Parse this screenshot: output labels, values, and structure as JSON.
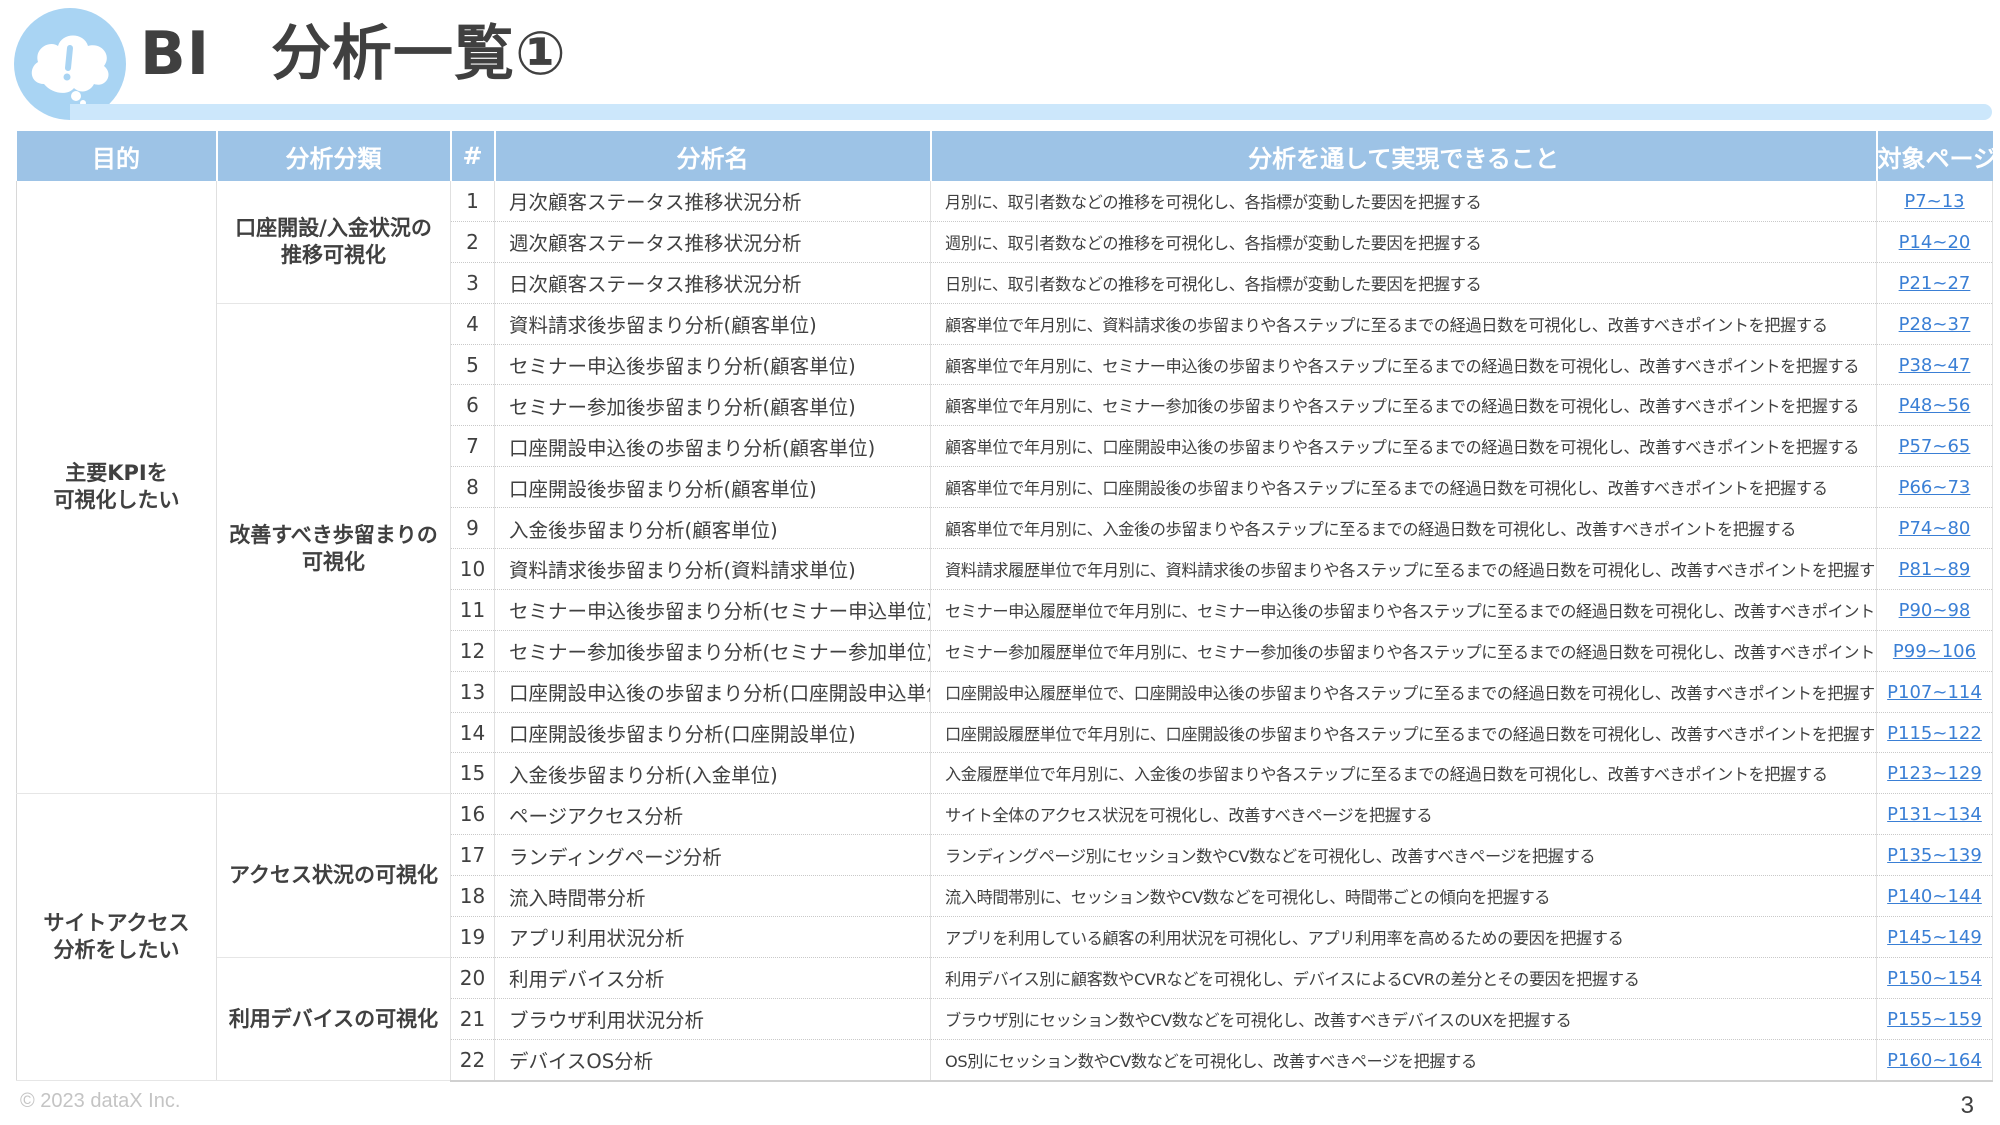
{
  "header": {
    "title": "BI　分析一覧①",
    "logo_icon": "cloud-exclamation-icon"
  },
  "table": {
    "columns": [
      "目的",
      "分析分類",
      "#",
      "分析名",
      "分析を通して実現できること",
      "対象ページ"
    ],
    "purposes": [
      "主要KPIを\n可視化したい",
      "サイトアクセス\n分析をしたい"
    ],
    "categories": [
      "口座開設/入金状況の\n推移可視化",
      "改善すべき歩留まりの\n可視化",
      "アクセス状況の可視化",
      "利用デバイスの可視化"
    ],
    "rows": [
      {
        "no": "1",
        "name": "月次顧客ステータス推移状況分析",
        "desc": "月別に、取引者数などの推移を可視化し、各指標が変動した要因を把握する",
        "page": "P7~13"
      },
      {
        "no": "2",
        "name": "週次顧客ステータス推移状況分析",
        "desc": "週別に、取引者数などの推移を可視化し、各指標が変動した要因を把握する",
        "page": "P14~20"
      },
      {
        "no": "3",
        "name": "日次顧客ステータス推移状況分析",
        "desc": "日別に、取引者数などの推移を可視化し、各指標が変動した要因を把握する",
        "page": "P21~27"
      },
      {
        "no": "4",
        "name": "資料請求後歩留まり分析(顧客単位)",
        "desc": "顧客単位で年月別に、資料請求後の歩留まりや各ステップに至るまでの経過日数を可視化し、改善すべきポイントを把握する",
        "page": "P28~37"
      },
      {
        "no": "5",
        "name": "セミナー申込後歩留まり分析(顧客単位)",
        "desc": "顧客単位で年月別に、セミナー申込後の歩留まりや各ステップに至るまでの経過日数を可視化し、改善すべきポイントを把握する",
        "page": "P38~47"
      },
      {
        "no": "6",
        "name": "セミナー参加後歩留まり分析(顧客単位)",
        "desc": "顧客単位で年月別に、セミナー参加後の歩留まりや各ステップに至るまでの経過日数を可視化し、改善すべきポイントを把握する",
        "page": "P48~56"
      },
      {
        "no": "7",
        "name": "口座開設申込後の歩留まり分析(顧客単位)",
        "desc": "顧客単位で年月別に、口座開設申込後の歩留まりや各ステップに至るまでの経過日数を可視化し、改善すべきポイントを把握する",
        "page": "P57~65"
      },
      {
        "no": "8",
        "name": "口座開設後歩留まり分析(顧客単位)",
        "desc": "顧客単位で年月別に、口座開設後の歩留まりや各ステップに至るまでの経過日数を可視化し、改善すべきポイントを把握する",
        "page": "P66~73"
      },
      {
        "no": "9",
        "name": "入金後歩留まり分析(顧客単位)",
        "desc": "顧客単位で年月別に、入金後の歩留まりや各ステップに至るまでの経過日数を可視化し、改善すべきポイントを把握する",
        "page": "P74~80"
      },
      {
        "no": "10",
        "name": "資料請求後歩留まり分析(資料請求単位)",
        "desc": "資料請求履歴単位で年月別に、資料請求後の歩留まりや各ステップに至るまでの経過日数を可視化し、改善すべきポイントを把握する",
        "page": "P81~89"
      },
      {
        "no": "11",
        "name": "セミナー申込後歩留まり分析(セミナー申込単位)",
        "desc": "セミナー申込履歴単位で年月別に、セミナー申込後の歩留まりや各ステップに至るまでの経過日数を可視化し、改善すべきポイントを把握する",
        "page": "P90~98"
      },
      {
        "no": "12",
        "name": "セミナー参加後歩留まり分析(セミナー参加単位)",
        "desc": "セミナー参加履歴単位で年月別に、セミナー参加後の歩留まりや各ステップに至るまでの経過日数を可視化し、改善すべきポイントを把握する",
        "page": "P99~106"
      },
      {
        "no": "13",
        "name": "口座開設申込後の歩留まり分析(口座開設申込単位)",
        "desc": "口座開設申込履歴単位で、口座開設申込後の歩留まりや各ステップに至るまでの経過日数を可視化し、改善すべきポイントを把握する",
        "page": "P107~114"
      },
      {
        "no": "14",
        "name": "口座開設後歩留まり分析(口座開設単位)",
        "desc": "口座開設履歴単位で年月別に、口座開設後の歩留まりや各ステップに至るまでの経過日数を可視化し、改善すべきポイントを把握する",
        "page": "P115~122"
      },
      {
        "no": "15",
        "name": "入金後歩留まり分析(入金単位)",
        "desc": "入金履歴単位で年月別に、入金後の歩留まりや各ステップに至るまでの経過日数を可視化し、改善すべきポイントを把握する",
        "page": "P123~129"
      },
      {
        "no": "16",
        "name": "ページアクセス分析",
        "desc": "サイト全体のアクセス状況を可視化し、改善すべきページを把握する",
        "page": "P131~134"
      },
      {
        "no": "17",
        "name": "ランディングページ分析",
        "desc": "ランディングページ別にセッション数やCV数などを可視化し、改善すべきページを把握する",
        "page": "P135~139"
      },
      {
        "no": "18",
        "name": "流入時間帯分析",
        "desc": "流入時間帯別に、セッション数やCV数などを可視化し、時間帯ごとの傾向を把握する",
        "page": "P140~144"
      },
      {
        "no": "19",
        "name": "アプリ利用状況分析",
        "desc": "アプリを利用している顧客の利用状況を可視化し、アプリ利用率を高めるための要因を把握する",
        "page": "P145~149"
      },
      {
        "no": "20",
        "name": "利用デバイス分析",
        "desc": "利用デバイス別に顧客数やCVRなどを可視化し、デバイスによるCVRの差分とその要因を把握する",
        "page": "P150~154"
      },
      {
        "no": "21",
        "name": "ブラウザ利用状況分析",
        "desc": "ブラウザ別にセッション数やCV数などを可視化し、改善すべきデバイスのUXを把握する",
        "page": "P155~159"
      },
      {
        "no": "22",
        "name": "デバイスOS分析",
        "desc": "OS別にセッション数やCV数などを可視化し、改善すべきページを把握する",
        "page": "P160~164"
      }
    ]
  },
  "footer": {
    "copyright": "© 2023 dataX Inc.",
    "page_number": "3"
  },
  "colors": {
    "header_bg": "#9dc3e6",
    "accent_light": "#cce7fb",
    "link": "#3a7fd5",
    "logo_bg": "#a9d4f3"
  }
}
